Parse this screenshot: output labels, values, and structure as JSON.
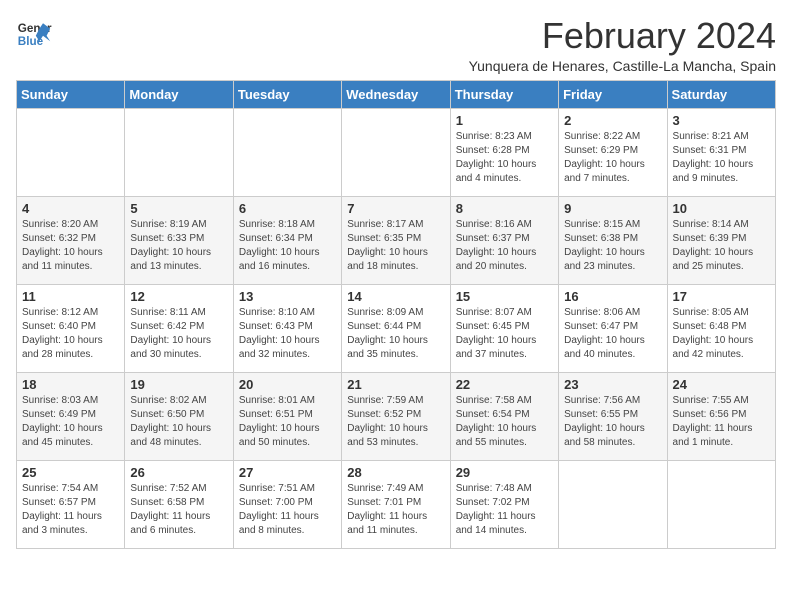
{
  "logo": {
    "line1": "General",
    "line2": "Blue"
  },
  "title": "February 2024",
  "subtitle": "Yunquera de Henares, Castille-La Mancha, Spain",
  "days_of_week": [
    "Sunday",
    "Monday",
    "Tuesday",
    "Wednesday",
    "Thursday",
    "Friday",
    "Saturday"
  ],
  "weeks": [
    [
      {
        "day": "",
        "detail": ""
      },
      {
        "day": "",
        "detail": ""
      },
      {
        "day": "",
        "detail": ""
      },
      {
        "day": "",
        "detail": ""
      },
      {
        "day": "1",
        "detail": "Sunrise: 8:23 AM\nSunset: 6:28 PM\nDaylight: 10 hours\nand 4 minutes."
      },
      {
        "day": "2",
        "detail": "Sunrise: 8:22 AM\nSunset: 6:29 PM\nDaylight: 10 hours\nand 7 minutes."
      },
      {
        "day": "3",
        "detail": "Sunrise: 8:21 AM\nSunset: 6:31 PM\nDaylight: 10 hours\nand 9 minutes."
      }
    ],
    [
      {
        "day": "4",
        "detail": "Sunrise: 8:20 AM\nSunset: 6:32 PM\nDaylight: 10 hours\nand 11 minutes."
      },
      {
        "day": "5",
        "detail": "Sunrise: 8:19 AM\nSunset: 6:33 PM\nDaylight: 10 hours\nand 13 minutes."
      },
      {
        "day": "6",
        "detail": "Sunrise: 8:18 AM\nSunset: 6:34 PM\nDaylight: 10 hours\nand 16 minutes."
      },
      {
        "day": "7",
        "detail": "Sunrise: 8:17 AM\nSunset: 6:35 PM\nDaylight: 10 hours\nand 18 minutes."
      },
      {
        "day": "8",
        "detail": "Sunrise: 8:16 AM\nSunset: 6:37 PM\nDaylight: 10 hours\nand 20 minutes."
      },
      {
        "day": "9",
        "detail": "Sunrise: 8:15 AM\nSunset: 6:38 PM\nDaylight: 10 hours\nand 23 minutes."
      },
      {
        "day": "10",
        "detail": "Sunrise: 8:14 AM\nSunset: 6:39 PM\nDaylight: 10 hours\nand 25 minutes."
      }
    ],
    [
      {
        "day": "11",
        "detail": "Sunrise: 8:12 AM\nSunset: 6:40 PM\nDaylight: 10 hours\nand 28 minutes."
      },
      {
        "day": "12",
        "detail": "Sunrise: 8:11 AM\nSunset: 6:42 PM\nDaylight: 10 hours\nand 30 minutes."
      },
      {
        "day": "13",
        "detail": "Sunrise: 8:10 AM\nSunset: 6:43 PM\nDaylight: 10 hours\nand 32 minutes."
      },
      {
        "day": "14",
        "detail": "Sunrise: 8:09 AM\nSunset: 6:44 PM\nDaylight: 10 hours\nand 35 minutes."
      },
      {
        "day": "15",
        "detail": "Sunrise: 8:07 AM\nSunset: 6:45 PM\nDaylight: 10 hours\nand 37 minutes."
      },
      {
        "day": "16",
        "detail": "Sunrise: 8:06 AM\nSunset: 6:47 PM\nDaylight: 10 hours\nand 40 minutes."
      },
      {
        "day": "17",
        "detail": "Sunrise: 8:05 AM\nSunset: 6:48 PM\nDaylight: 10 hours\nand 42 minutes."
      }
    ],
    [
      {
        "day": "18",
        "detail": "Sunrise: 8:03 AM\nSunset: 6:49 PM\nDaylight: 10 hours\nand 45 minutes."
      },
      {
        "day": "19",
        "detail": "Sunrise: 8:02 AM\nSunset: 6:50 PM\nDaylight: 10 hours\nand 48 minutes."
      },
      {
        "day": "20",
        "detail": "Sunrise: 8:01 AM\nSunset: 6:51 PM\nDaylight: 10 hours\nand 50 minutes."
      },
      {
        "day": "21",
        "detail": "Sunrise: 7:59 AM\nSunset: 6:52 PM\nDaylight: 10 hours\nand 53 minutes."
      },
      {
        "day": "22",
        "detail": "Sunrise: 7:58 AM\nSunset: 6:54 PM\nDaylight: 10 hours\nand 55 minutes."
      },
      {
        "day": "23",
        "detail": "Sunrise: 7:56 AM\nSunset: 6:55 PM\nDaylight: 10 hours\nand 58 minutes."
      },
      {
        "day": "24",
        "detail": "Sunrise: 7:55 AM\nSunset: 6:56 PM\nDaylight: 11 hours\nand 1 minute."
      }
    ],
    [
      {
        "day": "25",
        "detail": "Sunrise: 7:54 AM\nSunset: 6:57 PM\nDaylight: 11 hours\nand 3 minutes."
      },
      {
        "day": "26",
        "detail": "Sunrise: 7:52 AM\nSunset: 6:58 PM\nDaylight: 11 hours\nand 6 minutes."
      },
      {
        "day": "27",
        "detail": "Sunrise: 7:51 AM\nSunset: 7:00 PM\nDaylight: 11 hours\nand 8 minutes."
      },
      {
        "day": "28",
        "detail": "Sunrise: 7:49 AM\nSunset: 7:01 PM\nDaylight: 11 hours\nand 11 minutes."
      },
      {
        "day": "29",
        "detail": "Sunrise: 7:48 AM\nSunset: 7:02 PM\nDaylight: 11 hours\nand 14 minutes."
      },
      {
        "day": "",
        "detail": ""
      },
      {
        "day": "",
        "detail": ""
      }
    ]
  ]
}
